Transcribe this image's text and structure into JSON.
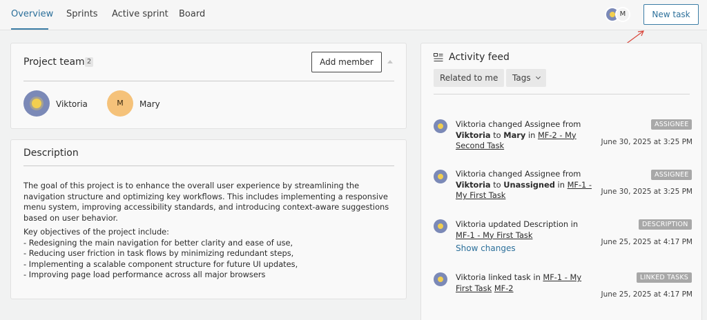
{
  "nav": {
    "tabs": [
      "Overview",
      "Sprints",
      "Active sprint",
      "Board"
    ],
    "active_tab": "Overview",
    "avatar_initial": "M",
    "new_task_label": "New task"
  },
  "team": {
    "title": "Project team",
    "count": "2",
    "add_member_label": "Add member",
    "members": [
      {
        "name": "Viktoria"
      },
      {
        "name": "Mary",
        "initial": "M"
      }
    ]
  },
  "description": {
    "title": "Description",
    "paragraph": "The goal of this project is to enhance the overall user experience by streamlining the navigation structure and optimizing key workflows. This includes implementing a responsive menu system, improving accessibility standards, and introducing context-aware suggestions based on user behavior.",
    "lines": [
      "Key objectives of the project include:",
      "- Redesigning the main navigation for better clarity and ease of use,",
      "- Reducing user friction in task flows by minimizing redundant steps,",
      "- Implementing a scalable component structure for future UI updates,",
      "- Improving page load performance across all major browsers"
    ]
  },
  "feed": {
    "title": "Activity feed",
    "filters": {
      "related": "Related to me",
      "tags": "Tags"
    },
    "items": [
      {
        "user": "Viktoria",
        "verb": "changed Assignee from",
        "from": "Viktoria",
        "mid": "to",
        "to": "Mary",
        "in": "in",
        "task": "MF-2 - My Second Task",
        "tag": "ASSIGNEE",
        "time": "June 30, 2025 at 3:25 PM"
      },
      {
        "user": "Viktoria",
        "verb": "changed Assignee from",
        "from": "Viktoria",
        "mid": "to",
        "to": "Unassigned",
        "in": "in",
        "task": "MF-1 - My First Task",
        "tag": "ASSIGNEE",
        "time": "June 30, 2025 at 3:25 PM"
      },
      {
        "user": "Viktoria",
        "verb": "updated Description in",
        "task": "MF-1 - My First Task",
        "show_changes": "Show changes",
        "tag": "DESCRIPTION",
        "time": "June 25, 2025 at 4:17 PM"
      },
      {
        "user": "Viktoria",
        "verb": "linked task in",
        "task": "MF-1 - My First Task",
        "linked": "MF-2",
        "tag": "LINKED TASKS",
        "time": "June 25, 2025 at 4:17 PM"
      }
    ]
  },
  "colors": {
    "accent": "#3a7ca5",
    "tag_bg": "#a8a8a8",
    "arrow": "#d9453a"
  }
}
